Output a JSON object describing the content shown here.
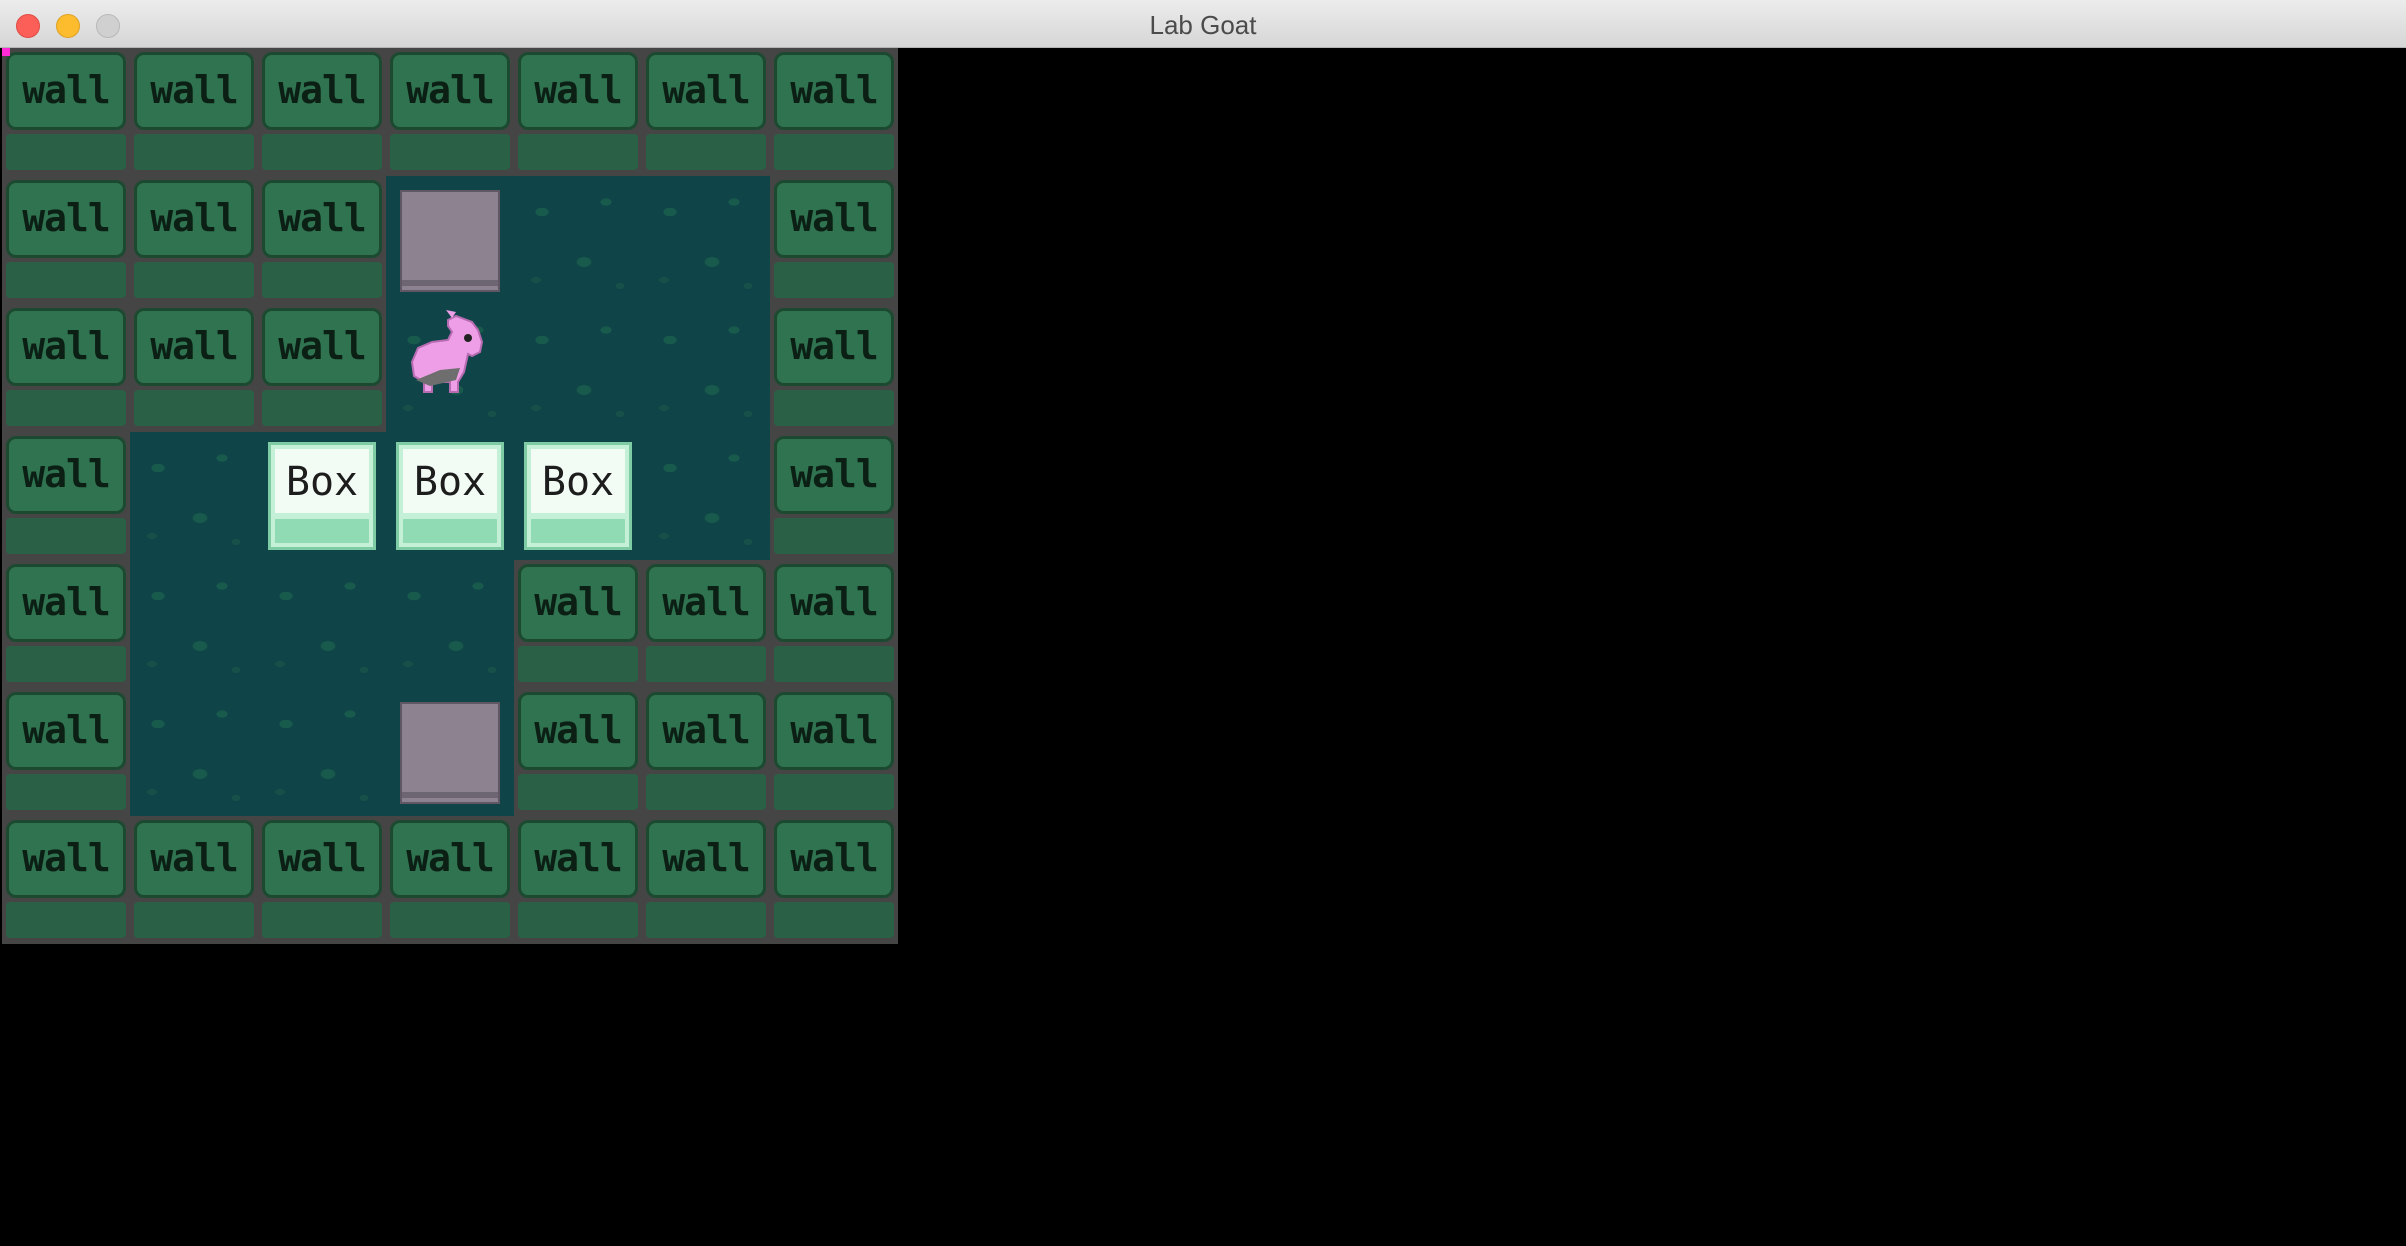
{
  "window": {
    "title": "Lab Goat",
    "buttons": [
      "close",
      "minimize",
      "zoom"
    ]
  },
  "game": {
    "grid_cols": 7,
    "grid_rows": 7,
    "legend": {
      "W": "wall",
      ".": "floor",
      "T": "target",
      "B": "box",
      "P": "goat"
    },
    "map": [
      "WWWWWWW",
      "WWWT..W",
      "WWWP..W",
      "W.BBB.W",
      "W...WWW",
      "W..TWWW",
      "WWWWWWW"
    ],
    "wall_label": "wall",
    "box_label": "Box",
    "colors": {
      "floor": "#0f4449",
      "wall": "#2f7350",
      "box": "#c5f0d8",
      "target": "#8c8290",
      "goat": "#ee9ee6",
      "background": "#000000"
    }
  }
}
